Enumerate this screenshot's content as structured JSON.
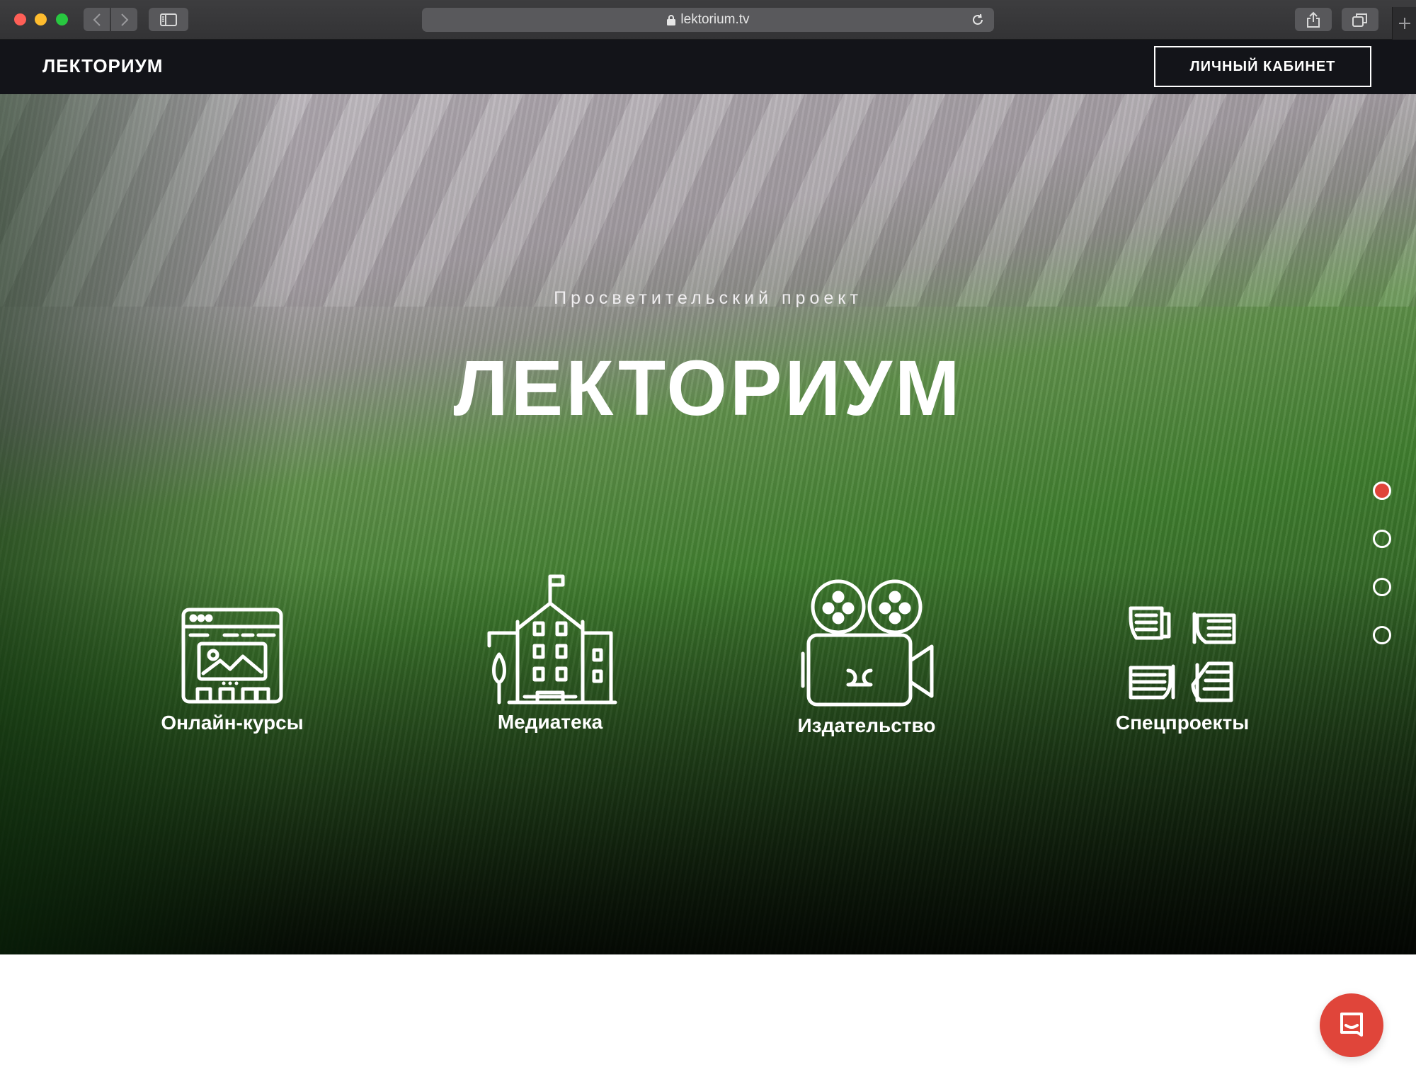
{
  "browser": {
    "url": "lektorium.tv"
  },
  "header": {
    "logo": "ЛЕКТОРИУМ",
    "cabinet_label": "ЛИЧНЫЙ КАБИНЕТ"
  },
  "hero": {
    "subtitle": "Просветительский проект",
    "title": "ЛЕКТОРИУМ",
    "services": [
      {
        "label": "Онлайн-курсы",
        "icon": "browser-window-icon"
      },
      {
        "label": "Медиатека",
        "icon": "building-icon"
      },
      {
        "label": "Издательство",
        "icon": "film-camera-icon"
      },
      {
        "label": "Спецпроекты",
        "icon": "hands-icon"
      }
    ],
    "slides": {
      "count": 4,
      "active": 1
    }
  },
  "colors": {
    "accent": "#e0453a",
    "header_bg": "#131419",
    "chrome_bg": "#3a3a3c"
  }
}
